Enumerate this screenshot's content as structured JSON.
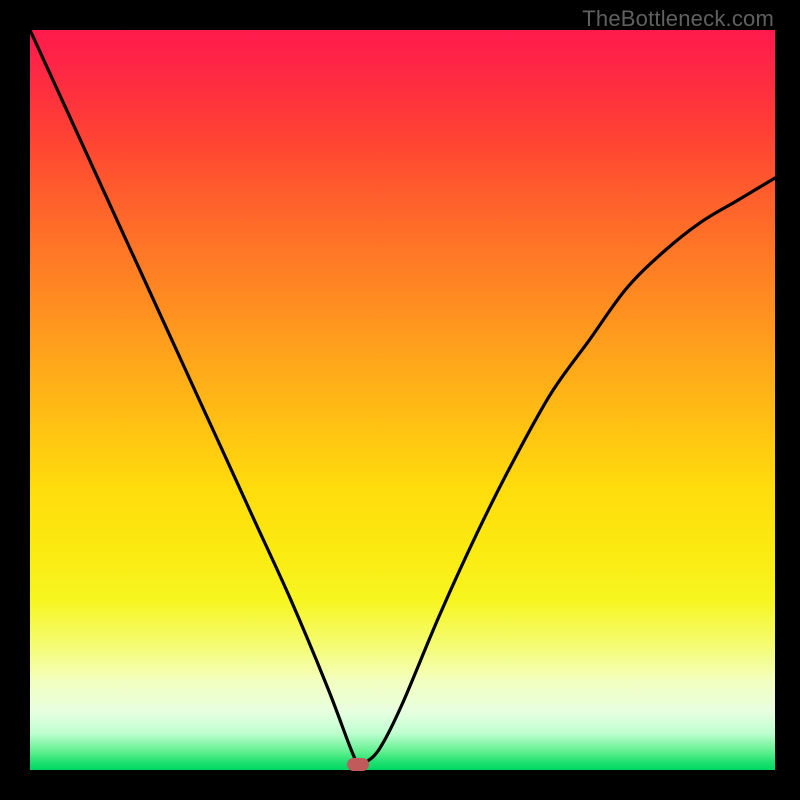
{
  "watermark": "TheBottleneck.com",
  "chart_data": {
    "type": "line",
    "title": "",
    "xlabel": "",
    "ylabel": "",
    "xlim": [
      0,
      100
    ],
    "ylim": [
      0,
      100
    ],
    "background": "vertical-gradient red→orange→yellow→green (high→low)",
    "series": [
      {
        "name": "curve",
        "x": [
          0,
          5,
          10,
          15,
          20,
          25,
          30,
          35,
          40,
          43,
          44,
          45,
          47,
          50,
          55,
          60,
          65,
          70,
          75,
          80,
          85,
          90,
          95,
          100
        ],
        "y": [
          100,
          89,
          78,
          67,
          56,
          45,
          34,
          23,
          11,
          3,
          1,
          1,
          3,
          9,
          21,
          32,
          42,
          51,
          58,
          65,
          70,
          74,
          77,
          80
        ]
      }
    ],
    "marker": {
      "x": 44,
      "y": 0.5,
      "color": "#c15b5b"
    },
    "grid": false,
    "legend": false
  },
  "colors": {
    "frame": "#000000",
    "marker": "#c15b5b",
    "curve": "#000000"
  }
}
